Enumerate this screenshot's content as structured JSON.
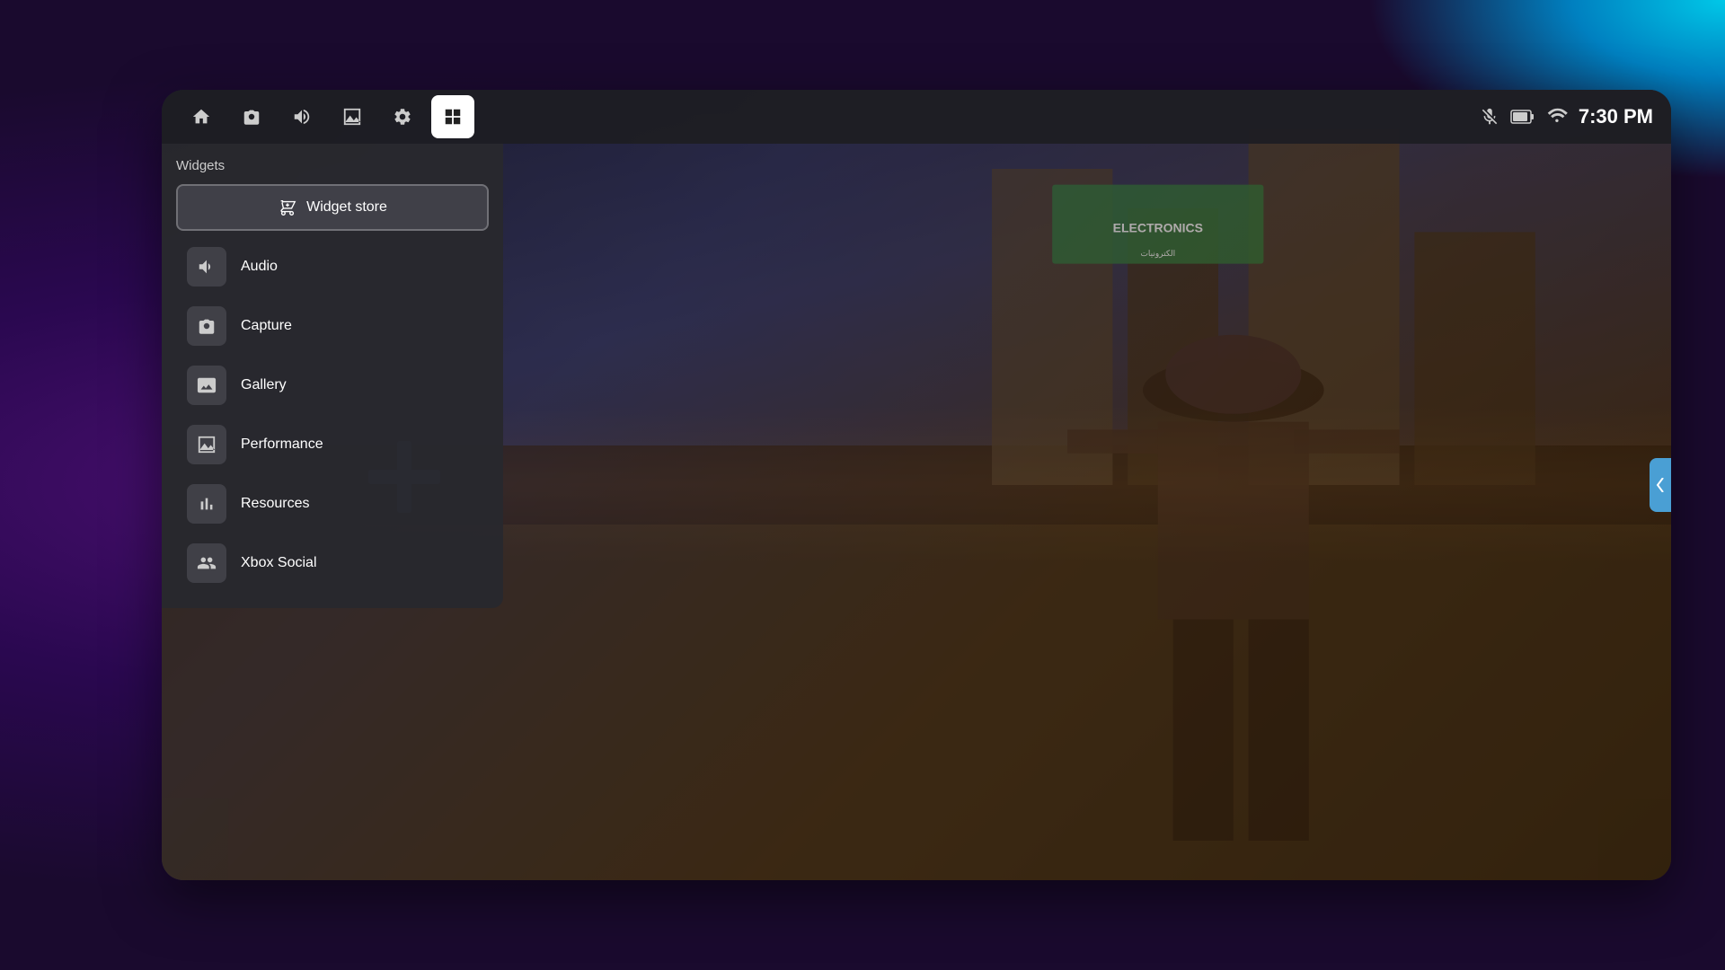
{
  "background": {
    "colors": {
      "bg_main": "#1a0a2e",
      "bg_purple": "#4a1070",
      "bg_teal": "#00c8e8",
      "device_bg": "#2a1a40"
    }
  },
  "topnav": {
    "icons": [
      {
        "name": "home",
        "symbol": "⌂",
        "label": "Home",
        "active": false
      },
      {
        "name": "capture",
        "symbol": "📷",
        "label": "Capture",
        "active": false
      },
      {
        "name": "audio",
        "symbol": "🔊",
        "label": "Audio",
        "active": false
      },
      {
        "name": "gallery",
        "symbol": "📊",
        "label": "Gallery",
        "active": false
      },
      {
        "name": "settings",
        "symbol": "⚙",
        "label": "Settings",
        "active": false
      },
      {
        "name": "widgets",
        "symbol": "⊞",
        "label": "Widgets",
        "active": true
      }
    ],
    "status": {
      "mute_icon": "🎤",
      "battery_icon": "🔋",
      "wifi_icon": "📶",
      "time": "7:30 PM"
    }
  },
  "widgets_panel": {
    "title": "Widgets",
    "store_button": {
      "label": "Widget store",
      "icon": "🛒"
    },
    "items": [
      {
        "id": "audio",
        "label": "Audio",
        "icon": "audio"
      },
      {
        "id": "capture",
        "label": "Capture",
        "icon": "capture"
      },
      {
        "id": "gallery",
        "label": "Gallery",
        "icon": "gallery"
      },
      {
        "id": "performance",
        "label": "Performance",
        "icon": "performance"
      },
      {
        "id": "resources",
        "label": "Resources",
        "icon": "resources"
      },
      {
        "id": "xbox-social",
        "label": "Xbox Social",
        "icon": "xbox-social"
      }
    ]
  },
  "game_scene": {
    "sign_text": "ELECTRONICS",
    "sign_arabic": "الكترونيات"
  }
}
